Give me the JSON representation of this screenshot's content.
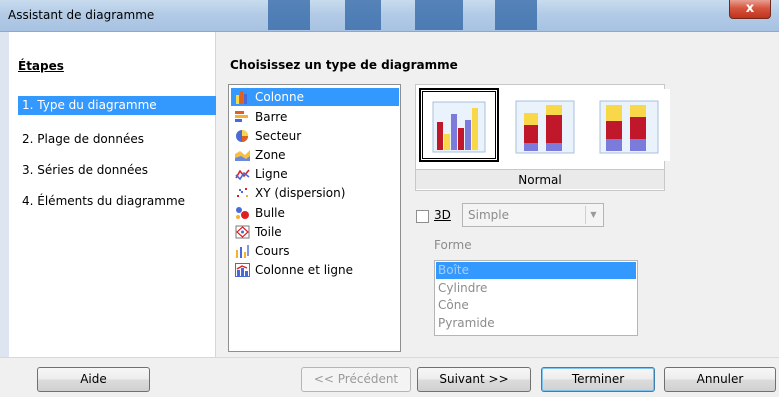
{
  "window": {
    "title": "Assistant de diagramme",
    "close_glyph": "x"
  },
  "steps": {
    "heading": "Étapes",
    "items": [
      {
        "label": "1. Type du diagramme",
        "active": true
      },
      {
        "label": "2. Plage de données",
        "active": false
      },
      {
        "label": "3. Séries de données",
        "active": false
      },
      {
        "label": "4. Éléments du diagramme",
        "active": false
      }
    ]
  },
  "chart_types": {
    "heading": "Choisissez un type de diagramme",
    "items": [
      {
        "label": "Colonne",
        "icon": "column-chart-icon",
        "selected": true
      },
      {
        "label": "Barre",
        "icon": "bar-chart-icon",
        "selected": false
      },
      {
        "label": "Secteur",
        "icon": "pie-chart-icon",
        "selected": false
      },
      {
        "label": "Zone",
        "icon": "area-chart-icon",
        "selected": false
      },
      {
        "label": "Ligne",
        "icon": "line-chart-icon",
        "selected": false
      },
      {
        "label": "XY (dispersion)",
        "icon": "scatter-chart-icon",
        "selected": false
      },
      {
        "label": "Bulle",
        "icon": "bubble-chart-icon",
        "selected": false
      },
      {
        "label": "Toile",
        "icon": "net-chart-icon",
        "selected": false
      },
      {
        "label": "Cours",
        "icon": "stock-chart-icon",
        "selected": false
      },
      {
        "label": "Colonne et ligne",
        "icon": "column-line-chart-icon",
        "selected": false
      }
    ]
  },
  "variants": {
    "caption": "Normal",
    "items": [
      {
        "name": "normal",
        "selected": true
      },
      {
        "name": "stacked",
        "selected": false
      },
      {
        "name": "percent-stacked",
        "selected": false
      }
    ]
  },
  "options_3d": {
    "label": "3D",
    "checked": false,
    "select_value": "Simple"
  },
  "forme": {
    "label": "Forme",
    "options": [
      {
        "label": "Boîte",
        "selected": true
      },
      {
        "label": "Cylindre",
        "selected": false
      },
      {
        "label": "Cône",
        "selected": false
      },
      {
        "label": "Pyramide",
        "selected": false
      }
    ]
  },
  "buttons": {
    "help": "Aide",
    "previous": "<< Précédent",
    "next": "Suivant >>",
    "finish": "Terminer",
    "cancel": "Annuler"
  },
  "colors": {
    "selection": "#3399ff",
    "bar_blue": "#7b7bdc",
    "bar_red": "#c0182a",
    "bar_yellow": "#f8d848"
  }
}
